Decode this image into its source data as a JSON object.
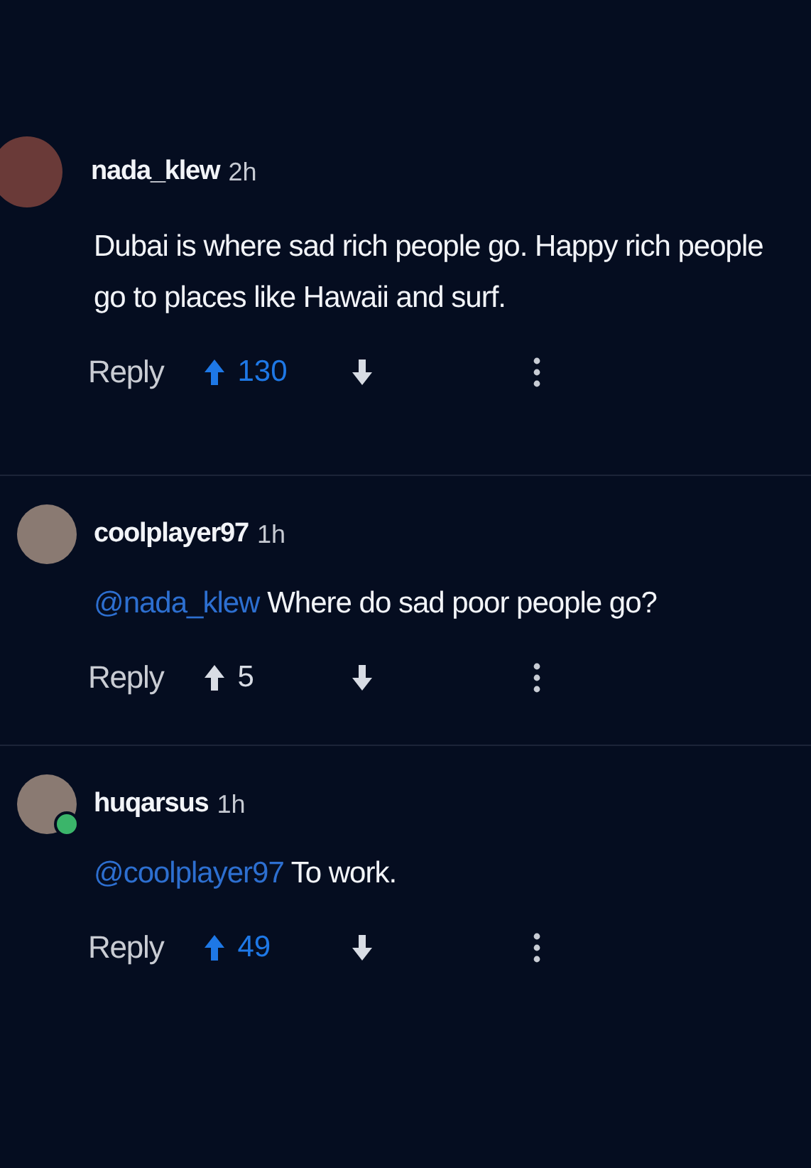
{
  "comments": [
    {
      "username": "nada_klew",
      "time": "2h",
      "text": "Dubai is where sad rich people go. Happy rich people go to places like Hawaii and surf.",
      "avatar_badge": false,
      "reply": "Reply",
      "score": "130",
      "upvoted": true
    },
    {
      "username": "coolplayer97",
      "time": "1h",
      "mention": "@nada_klew",
      "text": "Where do sad poor people go?",
      "avatar_badge": false,
      "reply": "Reply",
      "score": "5",
      "upvoted": false
    },
    {
      "username": "huqarsus",
      "time": "1h",
      "mention": "@coolplayer97",
      "text": "To work.",
      "avatar_badge": true,
      "reply": "Reply",
      "score": "49",
      "upvoted": true
    }
  ]
}
